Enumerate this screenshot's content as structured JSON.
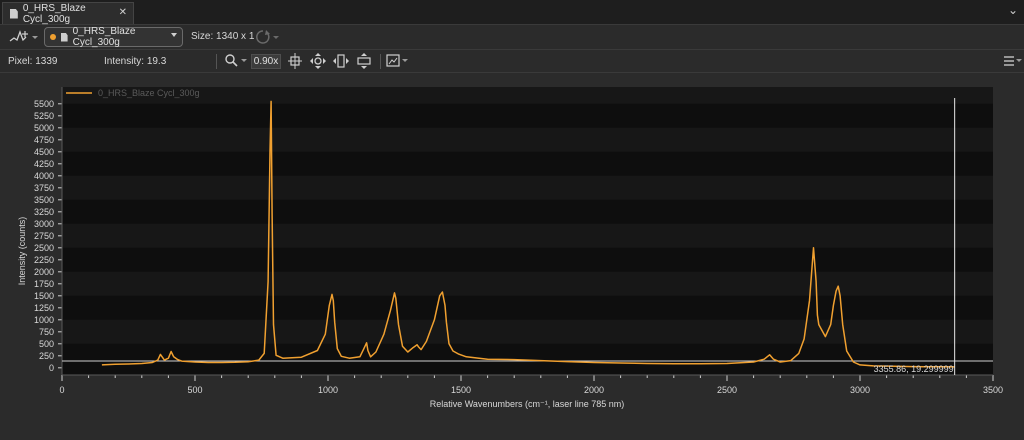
{
  "tab": {
    "title": "0_HRS_Blaze Cycl_300g",
    "close": "✕"
  },
  "toolbar": {
    "dataset_label": "0_HRS_Blaze Cycl_300g",
    "size_label": "Size:",
    "size_value": "1340 x 1",
    "zoom_value": "0.90x"
  },
  "status": {
    "pixel_label": "Pixel:",
    "pixel_value": "1339",
    "intensity_label": "Intensity:",
    "intensity_value": "19.3"
  },
  "colors": {
    "series": "#f0a030",
    "plot_bg": "#0e0e0e",
    "band": "#171717",
    "accent_dot": "#f0a030"
  },
  "chart_data": {
    "type": "line",
    "xlabel": "Relative Wavenumbers (cm⁻¹, laser line 785 nm)",
    "ylabel": "Intensity (counts)",
    "xlim": [
      0,
      3500
    ],
    "ylim": [
      -150,
      5850
    ],
    "x_ticks": [
      "0",
      "500",
      "1000",
      "1500",
      "2000",
      "2500",
      "3000",
      "3500"
    ],
    "y_ticks": [
      "0",
      "250",
      "500",
      "750",
      "1000",
      "1250",
      "1500",
      "1750",
      "2000",
      "2250",
      "2500",
      "2750",
      "3000",
      "3250",
      "3500",
      "3750",
      "4000",
      "4250",
      "4500",
      "4750",
      "5000",
      "5250",
      "5500"
    ],
    "legend": {
      "placement": "top-left"
    },
    "cursor": {
      "x": 3355.86,
      "label": "3355.86, 19.299999"
    },
    "series": [
      {
        "name": "0_HRS_Blaze Cycl_300g",
        "x": [
          150,
          200,
          250,
          300,
          340,
          360,
          370,
          385,
          400,
          410,
          420,
          435,
          450,
          500,
          550,
          600,
          650,
          700,
          740,
          760,
          775,
          782,
          786,
          790,
          795,
          805,
          830,
          900,
          960,
          990,
          1005,
          1015,
          1020,
          1025,
          1035,
          1050,
          1080,
          1120,
          1135,
          1145,
          1150,
          1160,
          1180,
          1210,
          1235,
          1250,
          1255,
          1265,
          1280,
          1300,
          1320,
          1335,
          1340,
          1350,
          1370,
          1400,
          1420,
          1430,
          1440,
          1445,
          1455,
          1470,
          1490,
          1520,
          1600,
          1700,
          1800,
          1900,
          2000,
          2100,
          2200,
          2300,
          2400,
          2500,
          2600,
          2640,
          2660,
          2675,
          2700,
          2740,
          2770,
          2790,
          2810,
          2825,
          2835,
          2840,
          2845,
          2855,
          2870,
          2890,
          2900,
          2910,
          2918,
          2925,
          2935,
          2950,
          2975,
          3000,
          3050,
          3100,
          3150,
          3200,
          3250,
          3300,
          3355
        ],
        "values": [
          60,
          75,
          80,
          90,
          110,
          160,
          280,
          160,
          200,
          340,
          230,
          170,
          140,
          120,
          110,
          110,
          115,
          125,
          160,
          300,
          1800,
          4500,
          5550,
          3200,
          900,
          260,
          200,
          220,
          360,
          700,
          1300,
          1530,
          1400,
          950,
          400,
          240,
          200,
          230,
          400,
          520,
          360,
          230,
          330,
          700,
          1200,
          1560,
          1450,
          900,
          450,
          330,
          420,
          480,
          440,
          380,
          550,
          1000,
          1500,
          1580,
          1300,
          950,
          500,
          350,
          290,
          230,
          180,
          170,
          150,
          130,
          110,
          100,
          90,
          85,
          85,
          90,
          120,
          180,
          270,
          180,
          120,
          150,
          300,
          600,
          1400,
          2500,
          1800,
          1100,
          900,
          800,
          650,
          900,
          1300,
          1600,
          1700,
          1500,
          900,
          350,
          120,
          60,
          40,
          35,
          30,
          25,
          22,
          20,
          19.3
        ]
      }
    ]
  }
}
